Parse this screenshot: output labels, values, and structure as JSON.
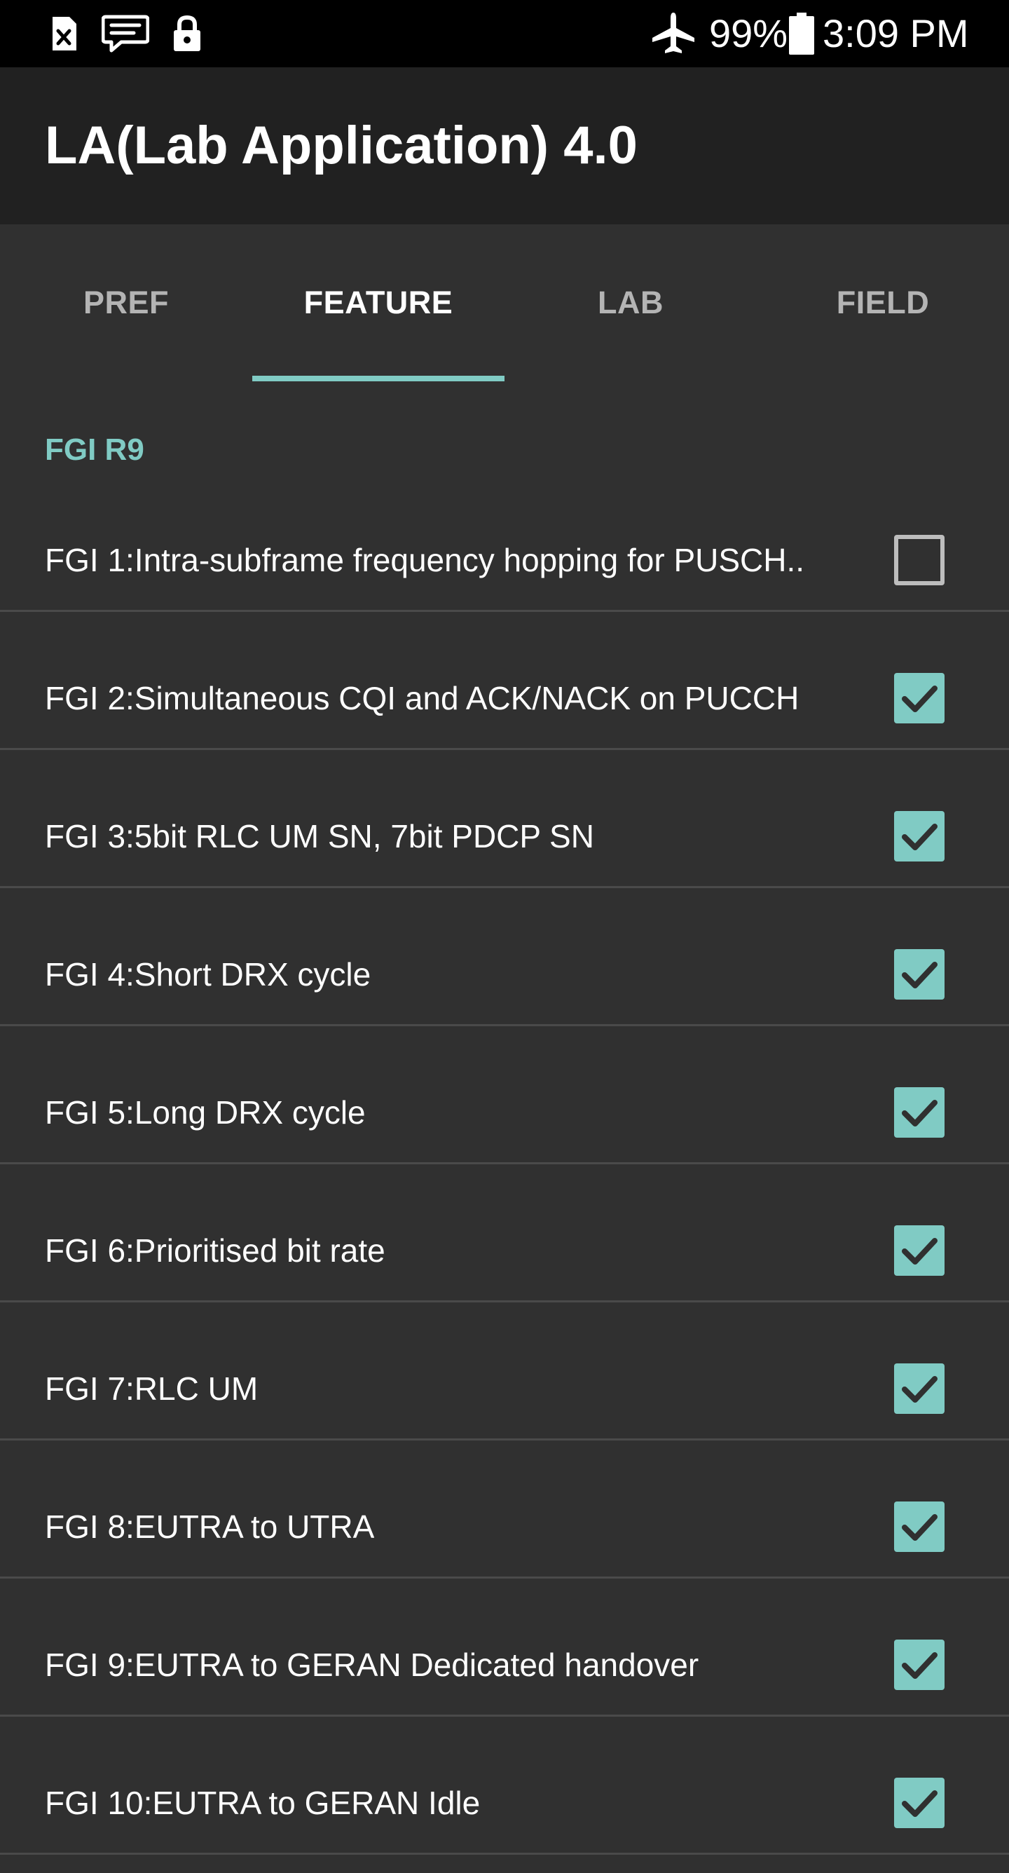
{
  "status_bar": {
    "battery_percent": "99%",
    "time": "3:09 PM",
    "icons": [
      "sim-missing-icon",
      "message-icon",
      "lock-icon",
      "airplane-mode-icon",
      "battery-icon"
    ]
  },
  "app_bar": {
    "title": "LA(Lab Application) 4.0"
  },
  "tabs": [
    {
      "label": "PREF",
      "active": false
    },
    {
      "label": "FEATURE",
      "active": true
    },
    {
      "label": "LAB",
      "active": false
    },
    {
      "label": "FIELD",
      "active": false
    }
  ],
  "section": {
    "header": "FGI R9"
  },
  "items": [
    {
      "label": "FGI 1:Intra-subframe frequency hopping for PUSCH..",
      "checked": false
    },
    {
      "label": "FGI 2:Simultaneous CQI and ACK/NACK on PUCCH",
      "checked": true
    },
    {
      "label": "FGI 3:5bit RLC UM SN, 7bit PDCP SN",
      "checked": true
    },
    {
      "label": "FGI 4:Short DRX cycle",
      "checked": true
    },
    {
      "label": "FGI 5:Long DRX cycle",
      "checked": true
    },
    {
      "label": "FGI 6:Prioritised bit rate",
      "checked": true
    },
    {
      "label": "FGI 7:RLC UM",
      "checked": true
    },
    {
      "label": "FGI 8:EUTRA to UTRA",
      "checked": true
    },
    {
      "label": "FGI 9:EUTRA to GERAN Dedicated handover",
      "checked": true
    },
    {
      "label": "FGI 10:EUTRA to GERAN Idle",
      "checked": true
    }
  ],
  "colors": {
    "accent": "#80cbc4",
    "background": "#303030",
    "app_bar": "#212121",
    "status_bar": "#000000"
  }
}
